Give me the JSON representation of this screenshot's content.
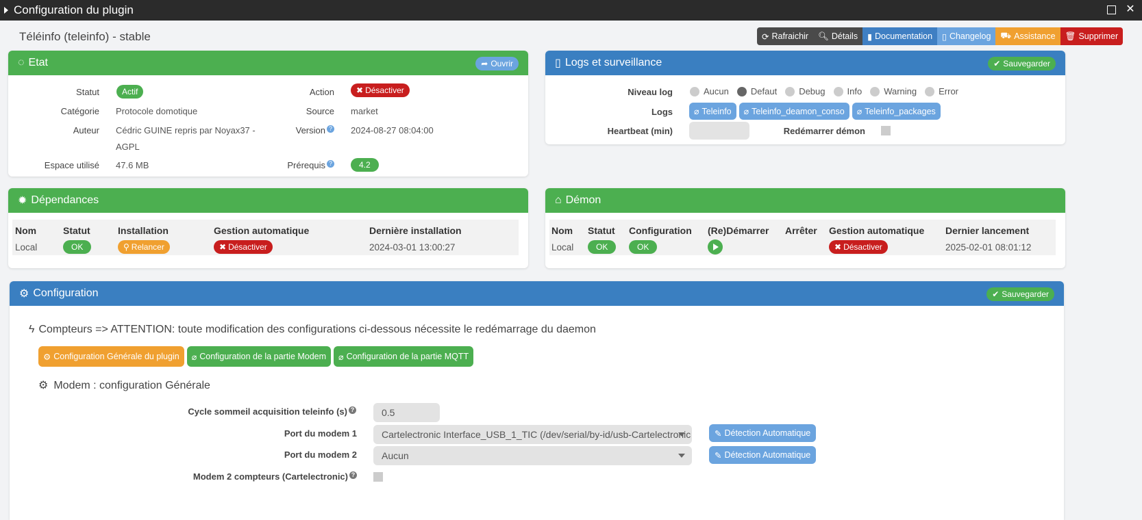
{
  "window": {
    "title": "Configuration du plugin"
  },
  "plugin": {
    "title": "Téléinfo (teleinfo) - stable"
  },
  "actions": {
    "refresh": "Rafraichir",
    "details": "Détails",
    "documentation": "Documentation",
    "changelog": "Changelog",
    "assistance": "Assistance",
    "delete": "Supprimer"
  },
  "etat": {
    "title": "Etat",
    "open_label": "Ouvrir",
    "statut_label": "Statut",
    "statut_value": "Actif",
    "categorie_label": "Catégorie",
    "categorie_value": "Protocole domotique",
    "auteur_label": "Auteur",
    "auteur_line1": "Cédric GUINE repris par Noyax37 -",
    "auteur_line2": "AGPL",
    "espace_label": "Espace utilisé",
    "espace_value": "47.6 MB",
    "action_label": "Action",
    "action_value": "Désactiver",
    "source_label": "Source",
    "source_value": "market",
    "version_label": "Version",
    "version_value": "2024-08-27 08:04:00",
    "prerequis_label": "Prérequis",
    "prerequis_value": "4.2"
  },
  "logs": {
    "title": "Logs et surveillance",
    "save_label": "Sauvegarder",
    "niveau_label": "Niveau log",
    "levels": [
      "Aucun",
      "Defaut",
      "Debug",
      "Info",
      "Warning",
      "Error"
    ],
    "selected_level": "Defaut",
    "logs_label": "Logs",
    "log_files": [
      "Teleinfo",
      "Teleinfo_deamon_conso",
      "Teleinfo_packages"
    ],
    "heartbeat_label": "Heartbeat (min)",
    "heartbeat_value": "",
    "restart_label": "Redémarrer démon"
  },
  "dependances": {
    "title": "Dépendances",
    "headers": [
      "Nom",
      "Statut",
      "Installation",
      "Gestion automatique",
      "Dernière installation"
    ],
    "row": {
      "nom": "Local",
      "statut": "OK",
      "installation": "Relancer",
      "gestion": "Désactiver",
      "derniere": "2024-03-01 13:00:27"
    }
  },
  "demon": {
    "title": "Démon",
    "headers": [
      "Nom",
      "Statut",
      "Configuration",
      "(Re)Démarrer",
      "Arrêter",
      "Gestion automatique",
      "Dernier lancement"
    ],
    "row": {
      "nom": "Local",
      "statut": "OK",
      "configuration": "OK",
      "gestion": "Désactiver",
      "dernier": "2025-02-01 08:01:12"
    }
  },
  "configuration": {
    "title": "Configuration",
    "save_label": "Sauvegarder",
    "warning": "Compteurs => ATTENTION: toute modification des configurations ci-dessous nécessite le redémarrage du daemon",
    "tabs": [
      "Configuration Générale du plugin",
      "Configuration de la partie Modem",
      "Configuration de la partie MQTT"
    ],
    "section_title": "Modem : configuration Générale",
    "cycle_label": "Cycle sommeil acquisition teleinfo (s)",
    "cycle_value": "0.5",
    "port1_label": "Port du modem 1",
    "port1_value": "Cartelectronic Interface_USB_1_TIC (/dev/serial/by-id/usb-Cartelectronic",
    "port2_label": "Port du modem 2",
    "port2_value": "Aucun",
    "detect_label": "Détection Automatique",
    "modem2_label": "Modem 2 compteurs (Cartelectronic)"
  },
  "colors": {
    "green": "#4caf50",
    "blue": "#3a7fc1",
    "light_blue": "#6ba4df",
    "orange": "#f0a030",
    "red": "#c81e1e"
  }
}
